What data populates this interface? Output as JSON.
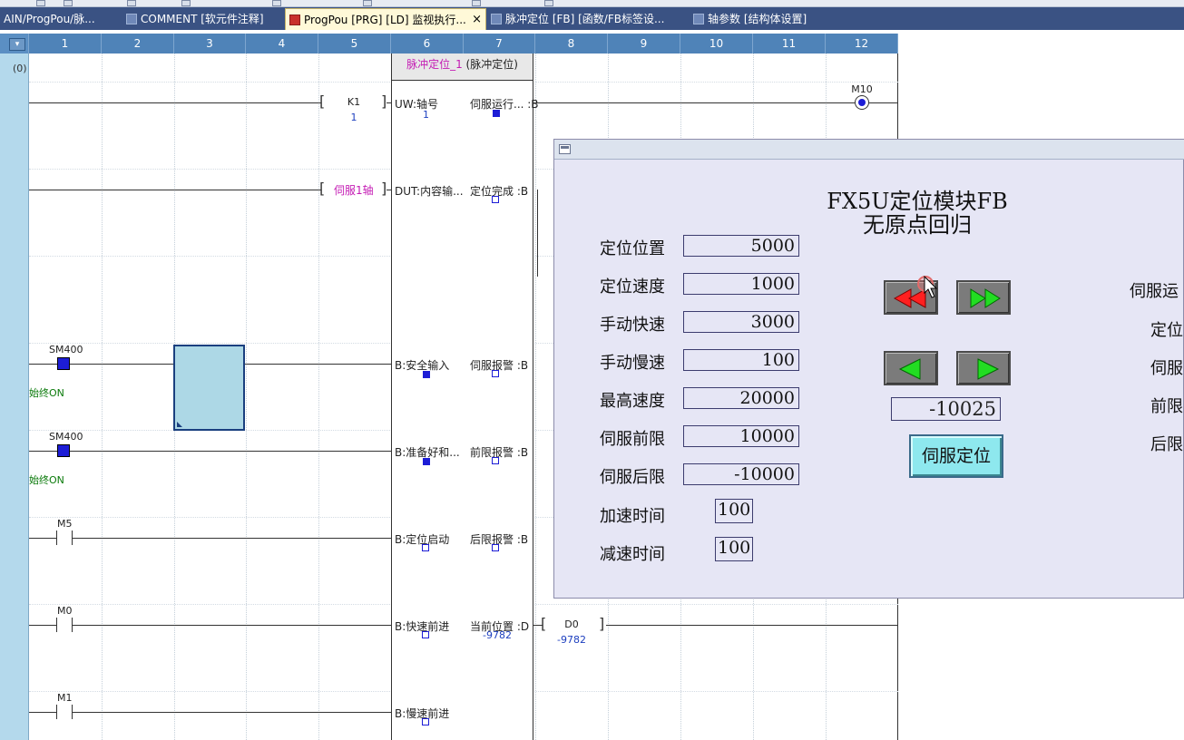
{
  "tabs": [
    {
      "label": "AIN/ProgPou/脉...",
      "active": false
    },
    {
      "label": "COMMENT [软元件注释]",
      "active": false
    },
    {
      "label": "ProgPou [PRG] [LD] 监视执行...",
      "active": true,
      "close": "×"
    },
    {
      "label": "脉冲定位 [FB] [函数/FB标签设...",
      "active": false
    },
    {
      "label": "轴参数 [结构体设置]",
      "active": false
    }
  ],
  "columns": [
    "1",
    "2",
    "3",
    "4",
    "5",
    "6",
    "7",
    "8",
    "9",
    "10",
    "11",
    "12"
  ],
  "corner_glyph": "▾",
  "step_number": "(0)",
  "fb": {
    "instance": "脉冲定位_1",
    "type": "(脉冲定位)",
    "inputs": [
      "UW:轴号",
      "DUT:内容输...",
      "B:安全输入",
      "B:准备好和...",
      "B:定位启动",
      "B:快速前进",
      "B:慢速前进"
    ],
    "outputs": [
      "伺服运行... :B",
      "定位完成 :B",
      "伺服报警 :B",
      "前限报警 :B",
      "后限报警 :B",
      "当前位置 :D"
    ],
    "axis_value": "1",
    "current_pos_value": "-9782"
  },
  "ladder": {
    "const_k1": "K1",
    "const_k1_val": "1",
    "servo_axis": "伺服1轴",
    "contacts": [
      {
        "name": "SM400",
        "comment": "始终ON",
        "state": "on"
      },
      {
        "name": "SM400",
        "comment": "始终ON",
        "state": "on"
      },
      {
        "name": "M5",
        "state": "off"
      },
      {
        "name": "M0",
        "state": "off"
      },
      {
        "name": "M1",
        "state": "off"
      }
    ],
    "coil": "M10",
    "d0": "D0",
    "d0_val": "-9782"
  },
  "hmi": {
    "title_line1": "FX5U定位模块FB",
    "title_line2": "无原点回归",
    "params": [
      {
        "label": "定位位置",
        "value": "5000"
      },
      {
        "label": "定位速度",
        "value": "1000"
      },
      {
        "label": "手动快速",
        "value": "3000"
      },
      {
        "label": "手动慢速",
        "value": "100"
      },
      {
        "label": "最高速度",
        "value": "20000"
      },
      {
        "label": "伺服前限",
        "value": "10000"
      },
      {
        "label": "伺服后限",
        "value": "-10000"
      },
      {
        "label": "加速时间",
        "value": "100"
      },
      {
        "label": "减速时间",
        "value": "100"
      }
    ],
    "position_display": "-10025",
    "servo_button": "伺服定位",
    "right_labels": [
      "伺服运",
      "定位",
      "伺服",
      "前限",
      "后限"
    ],
    "colors": {
      "jog_red": "#ff2020",
      "jog_green": "#22dd22",
      "servo_btn": "#8ee8ee"
    }
  }
}
